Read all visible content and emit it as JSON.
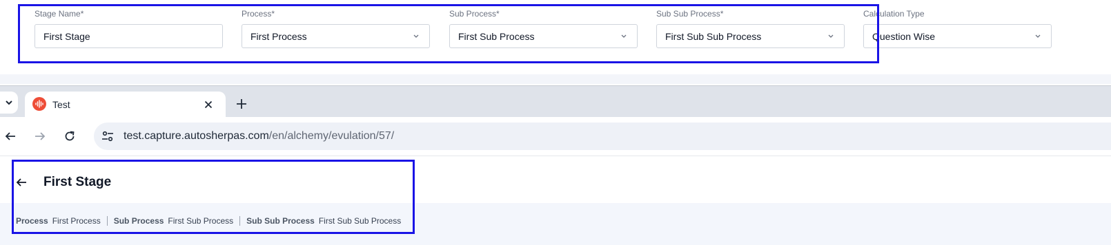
{
  "form": {
    "fields": [
      {
        "label": "Stage Name*",
        "value": "First Stage",
        "kind": "text"
      },
      {
        "label": "Process*",
        "value": "First Process",
        "kind": "select"
      },
      {
        "label": "Sub Process*",
        "value": "First Sub Process",
        "kind": "select"
      },
      {
        "label": "Sub Sub Process*",
        "value": "First Sub Sub Process",
        "kind": "select"
      },
      {
        "label": "Calculation Type",
        "value": "Question Wise",
        "kind": "select"
      }
    ]
  },
  "browser": {
    "tab_title": "Test",
    "url_host": "test.capture.autosherpas.com",
    "url_path": "/en/alchemy/evulation/57/"
  },
  "page": {
    "title": "First Stage",
    "meta": [
      {
        "key": "Process",
        "value": "First Process"
      },
      {
        "key": "Sub Process",
        "value": "First Sub Process"
      },
      {
        "key": "Sub Sub Process",
        "value": "First Sub Sub Process"
      }
    ]
  },
  "colors": {
    "highlight": "#1a14e6",
    "favicon": "#ee4d37"
  }
}
